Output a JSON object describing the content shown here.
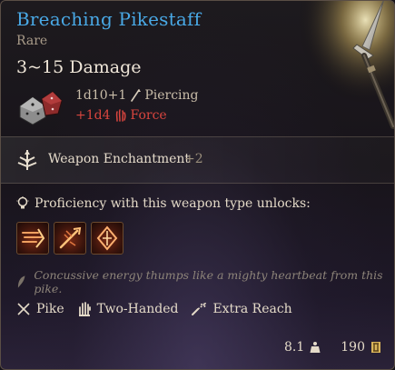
{
  "item": {
    "name": "Breaching Pikestaff",
    "rarity": "Rare",
    "damage_total": "3~15 Damage"
  },
  "damage": {
    "base_dice": "1d10+1",
    "base_type": "Piercing",
    "bonus_dice": "+1d4",
    "bonus_type": "Force",
    "colors": {
      "base": "#c9bda9",
      "bonus": "#d8453e"
    }
  },
  "enchantment": {
    "label": "Weapon Enchantment",
    "bonus": "+2"
  },
  "proficiency": {
    "text": "Proficiency with this weapon type unlocks:",
    "actions": [
      {
        "icon": "rush-attack-icon"
      },
      {
        "icon": "pommel-strike-icon"
      },
      {
        "icon": "lacerate-icon"
      }
    ]
  },
  "description": "Concussive energy thumps like a mighty heartbeat from this pike.",
  "properties": [
    "Pike",
    "Two-Handed",
    "Extra Reach"
  ],
  "footer": {
    "weight": "8.1",
    "value": "190"
  },
  "colors": {
    "title": "#49a9e6",
    "rarity": "#a99b89",
    "force": "#d8453e",
    "action_frame": "#6b4a2e"
  }
}
